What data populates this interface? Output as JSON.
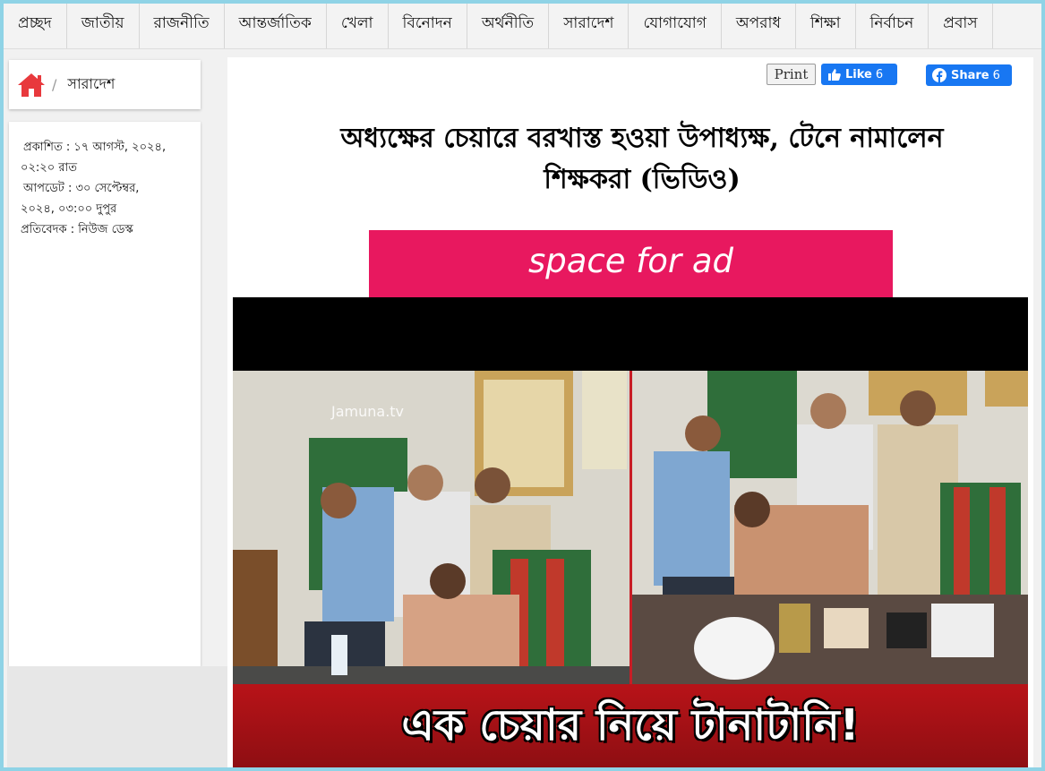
{
  "nav": {
    "items": [
      {
        "label": "প্রচ্ছদ"
      },
      {
        "label": "জাতীয়"
      },
      {
        "label": "রাজনীতি"
      },
      {
        "label": "আন্তর্জাতিক"
      },
      {
        "label": "খেলা"
      },
      {
        "label": "বিনোদন"
      },
      {
        "label": "অর্থনীতি"
      },
      {
        "label": "সারাদেশ"
      },
      {
        "label": "যোগাযোগ"
      },
      {
        "label": "অপরাধ"
      },
      {
        "label": "শিক্ষা"
      },
      {
        "label": "নির্বাচন"
      },
      {
        "label": "প্রবাস"
      }
    ]
  },
  "breadcrumb": {
    "home_icon": "home-icon",
    "separator": "/",
    "current": "সারাদেশ"
  },
  "meta": {
    "published": "প্রকাশিত : ১৭ আগস্ট, ২০২৪,",
    "published_time": "০২:২০ রাত",
    "updated": "আপডেট : ৩০ সেপ্টেম্বর,",
    "updated_time": "২০২৪, ০৩:০০ দুপুর",
    "reporter": "প্রতিবেদক : নিউজ ডেস্ক"
  },
  "actions": {
    "print_label": "Print",
    "like_label": "Like",
    "like_count": "6",
    "share_label": "Share",
    "share_count": "6"
  },
  "article": {
    "headline_line1": "অধ্যক্ষের চেয়ারে বরখাস্ত হওয়া উপাধ্যক্ষ, টেনে নামালেন",
    "headline_line2": "শিক্ষকরা (ভিডিও)"
  },
  "ad": {
    "label": "space for ad"
  },
  "video": {
    "watermark": "Jamuna.tv",
    "caption": "এক চেয়ার নিয়ে টানাটানি!"
  },
  "colors": {
    "frame": "#8fd3e6",
    "home_icon": "#e8393d",
    "facebook": "#1877f2",
    "ad_background": "#e8185f",
    "caption_bar": "#b81318"
  }
}
